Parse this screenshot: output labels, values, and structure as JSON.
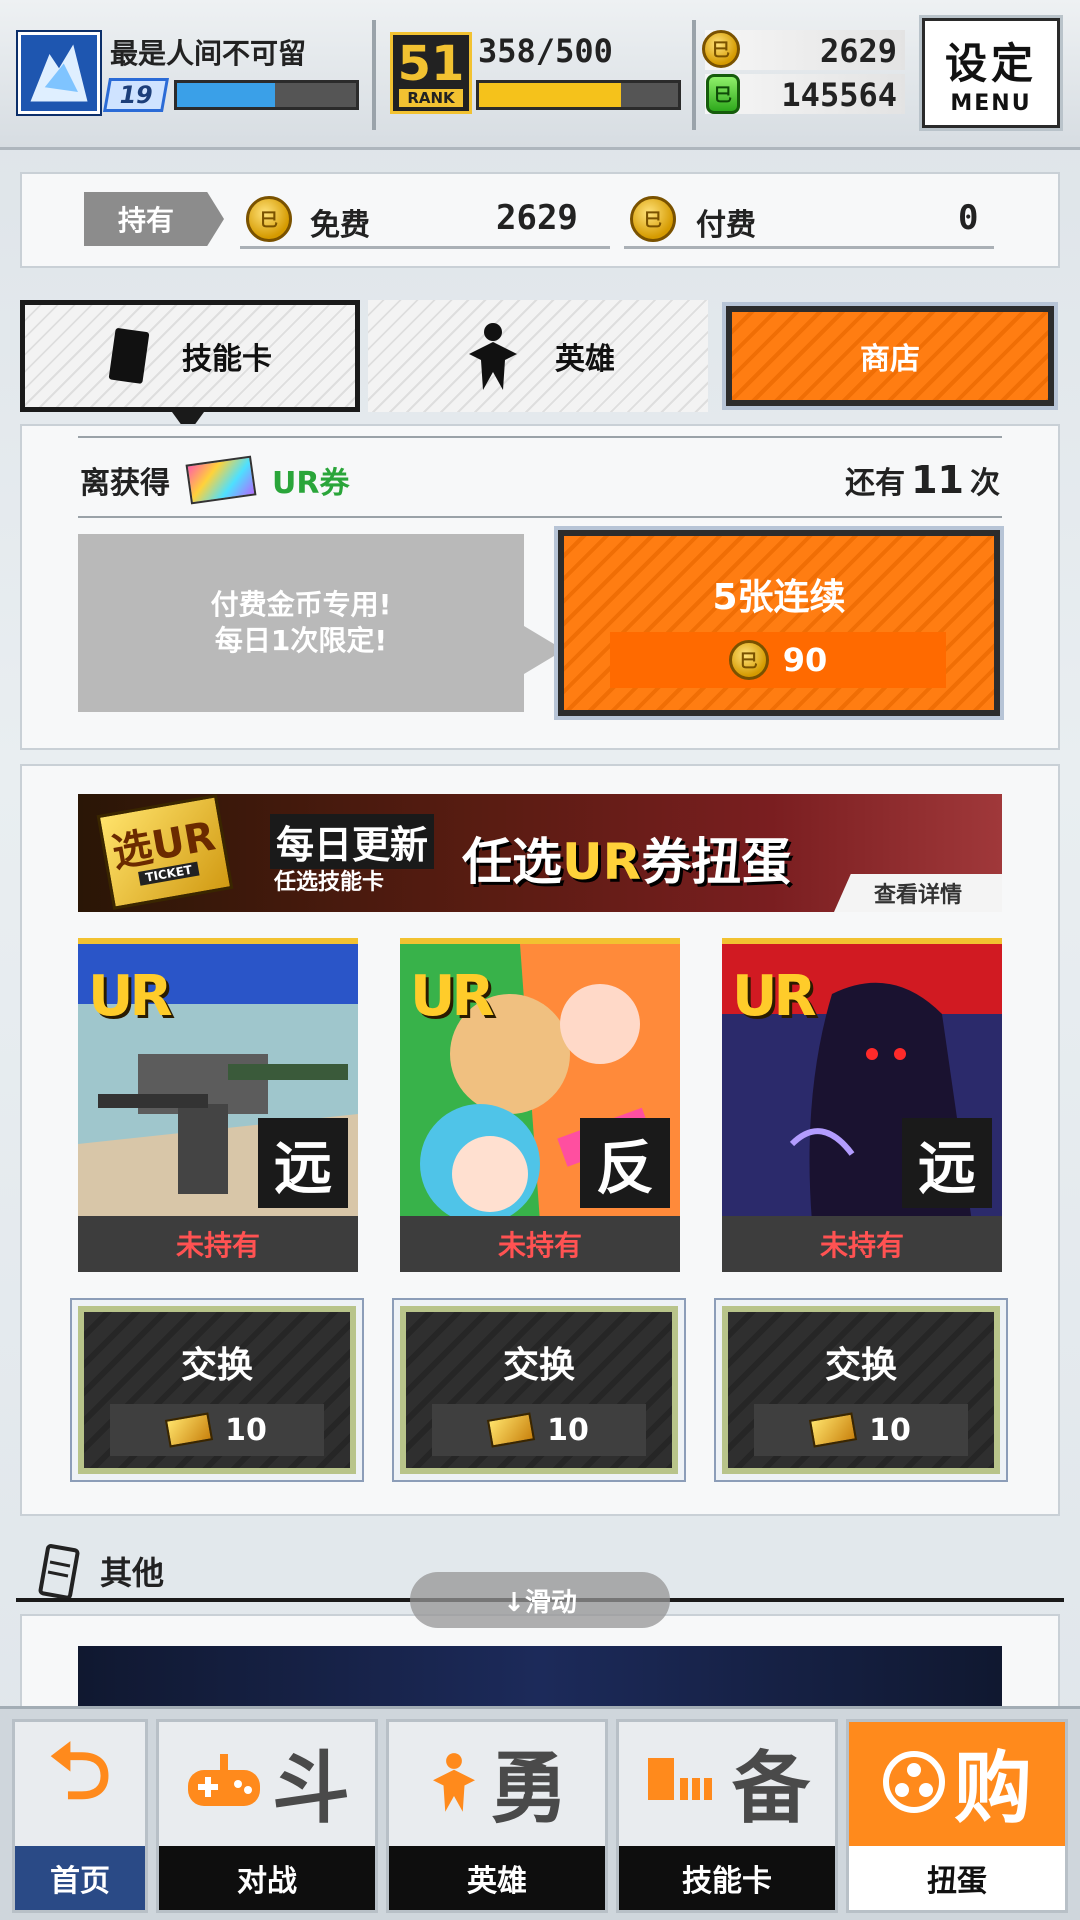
{
  "player": {
    "name": "最是人间不可留",
    "level": "19",
    "exp_fraction": 0.55
  },
  "rank": {
    "number": "51",
    "label": "RANK",
    "stamina": "358/500",
    "stamina_fraction": 0.716
  },
  "currency": {
    "coins": "2629",
    "coin_symbol": "巳",
    "gems": "145564",
    "gem_symbol": "巳"
  },
  "menu": {
    "kanji": "设定",
    "sub": "MENU"
  },
  "holdings": {
    "tag": "持有",
    "free_label": "免费",
    "free_value": "2629",
    "paid_label": "付费",
    "paid_value": "0"
  },
  "tabs": [
    {
      "label": "技能卡"
    },
    {
      "label": "英雄"
    },
    {
      "label": "商店"
    }
  ],
  "ur_progress": {
    "prefix": "离获得",
    "ticket_label": "UR券",
    "remaining_prefix": "还有",
    "remaining_count": "11",
    "remaining_suffix": "次"
  },
  "paid_info": {
    "line1": "付费金币专用!",
    "line2": "每日1次限定!"
  },
  "pull_button": {
    "title": "5张连续",
    "cost": "90"
  },
  "banner": {
    "ticket_big": "选UR",
    "ticket_sub": "TICKET",
    "daily": "每日更新",
    "daily_sub": "任选技能卡",
    "main_prefix": "任选",
    "main_ur": "UR",
    "main_suffix": "券扭蛋",
    "details": "查看详情"
  },
  "cards": [
    {
      "rarity": "UR",
      "type": "远",
      "status": "未持有"
    },
    {
      "rarity": "UR",
      "type": "反",
      "status": "未持有"
    },
    {
      "rarity": "UR",
      "type": "远",
      "status": "未持有"
    }
  ],
  "exchange": [
    {
      "label": "交换",
      "cost": "10"
    },
    {
      "label": "交换",
      "cost": "10"
    },
    {
      "label": "交换",
      "cost": "10"
    }
  ],
  "other": {
    "title": "其他",
    "scroll_hint": "↓滑动"
  },
  "nav": [
    {
      "label": "首页",
      "glyph": "⮌"
    },
    {
      "label": "对战",
      "glyph": "斗"
    },
    {
      "label": "英雄",
      "glyph": "勇"
    },
    {
      "label": "技能卡",
      "glyph": "备"
    },
    {
      "label": "扭蛋",
      "glyph": "购"
    }
  ],
  "colors": {
    "accent_orange": "#f06e05",
    "exp_blue": "#3aa0e8",
    "stamina_yellow": "#f5c21b",
    "status_red": "#ff5252"
  }
}
